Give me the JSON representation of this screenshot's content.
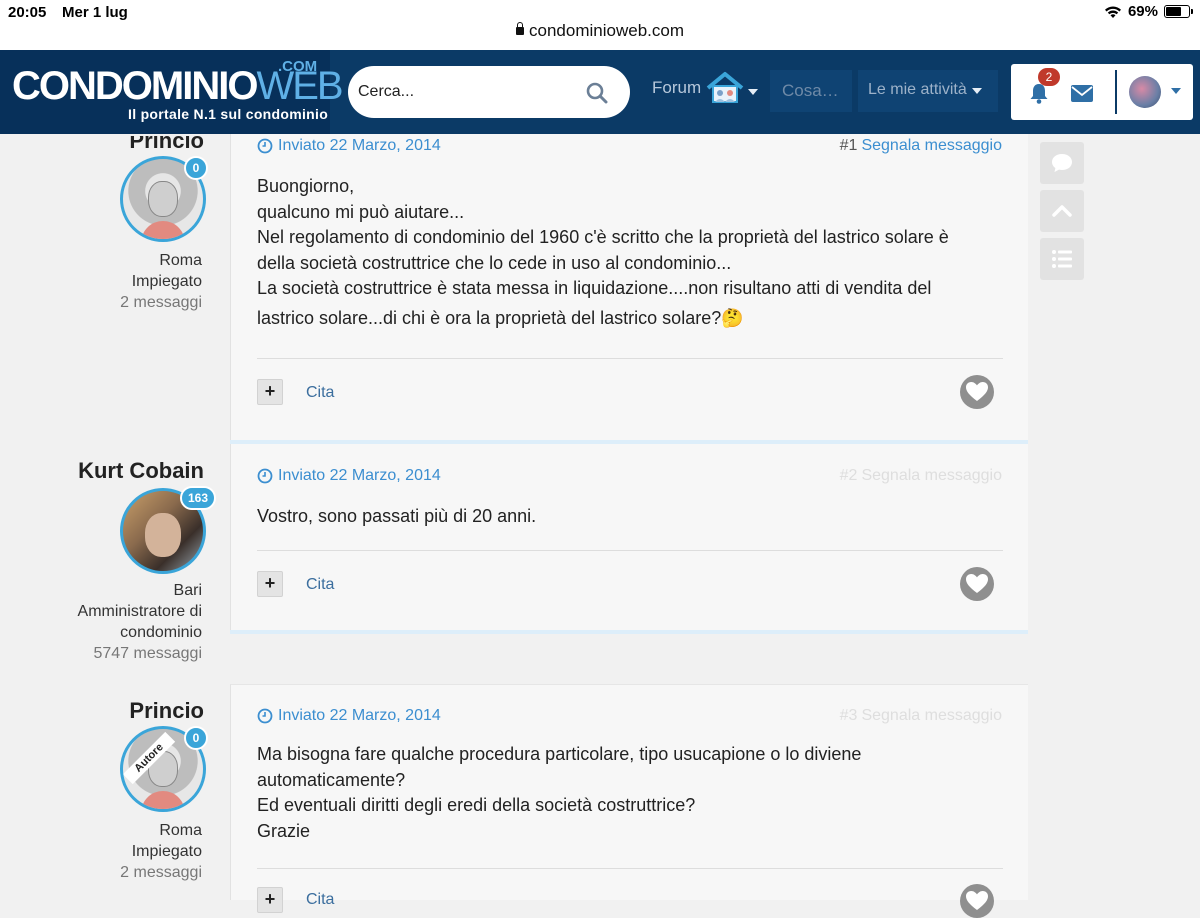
{
  "status_bar": {
    "time": "20:05",
    "date": "Mer 1 lug",
    "battery": "69%",
    "battery_level": 0.69,
    "url": "condominioweb.com"
  },
  "header": {
    "logo_main": "CONDOMINIO",
    "logo_web": "WEB",
    "logo_com": ".COM",
    "logo_tagline": "Il portale N.1 sul condominio",
    "search_placeholder": "Cerca...",
    "nav_forum": "Forum",
    "nav_cosa": "Cosa…",
    "nav_mie": "Le mie attività",
    "notifications_count": "2",
    "colors": {
      "header_bg": "#0b3a66",
      "accent": "#3aa5d9",
      "badge": "#c0392b"
    }
  },
  "posts": [
    {
      "author": "Princio",
      "post_count_badge": "0",
      "location": "Roma",
      "role": "Impiegato",
      "messages": "2 messaggi",
      "time": "Inviato 22 Marzo, 2014",
      "number": "#1",
      "report": "Segnala messaggio",
      "body": [
        "Buongiorno,",
        "qualcuno mi può aiutare...",
        "Nel regolamento di condominio del 1960 c'è scritto che la proprietà del lastrico solare è",
        "della società costruttrice che lo cede in uso al condominio...",
        "La società costruttrice è stata messa in liquidazione....non risultano atti di vendita del",
        "lastrico solare...di chi è ora la proprietà del lastrico solare?🤔"
      ],
      "quote": "Cita"
    },
    {
      "author": "Kurt Cobain",
      "post_count_badge": "163",
      "location": "Bari",
      "role_line1": "Amministratore di",
      "role_line2": "condominio",
      "messages": "5747 messaggi",
      "time": "Inviato 22 Marzo, 2014",
      "number": "#2",
      "report": "Segnala messaggio",
      "body": [
        "Vostro, sono passati più di 20 anni."
      ],
      "quote": "Cita"
    },
    {
      "author": "Princio",
      "ribbon": "Autore",
      "post_count_badge": "0",
      "location": "Roma",
      "role": "Impiegato",
      "messages": "2 messaggi",
      "time": "Inviato 22 Marzo, 2014",
      "number": "#3",
      "report": "Segnala messaggio",
      "body": [
        "Ma bisogna fare qualche procedura particolare, tipo usucapione o lo diviene",
        "automaticamente?",
        "Ed eventuali diritti degli eredi della società costruttrice?",
        "Grazie"
      ],
      "quote": "Cita"
    }
  ],
  "floating_buttons": [
    "comment-icon",
    "chevron-up-icon",
    "list-icon"
  ]
}
